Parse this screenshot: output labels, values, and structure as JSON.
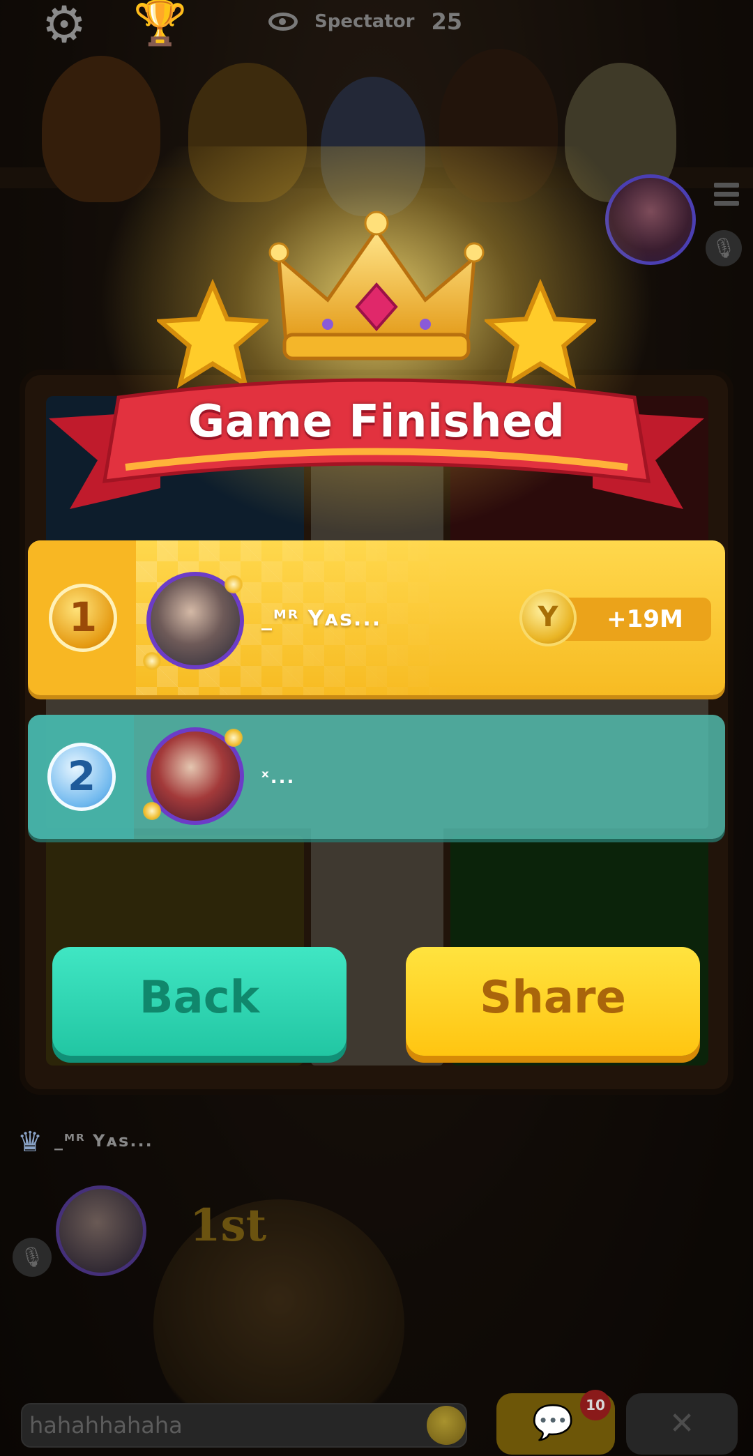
{
  "top_bar": {
    "spectator_label": "Spectator",
    "spectator_count": "25"
  },
  "modal": {
    "title": "Game Finished",
    "ranks": [
      {
        "position": "1",
        "player_name": "_ᴹᴿ Yᴀs...",
        "reward": "+19M"
      },
      {
        "position": "2",
        "player_name": "ˣ..."
      }
    ],
    "back_label": "Back",
    "share_label": "Share"
  },
  "bottom": {
    "player_name": "_ᴹᴿ Yᴀs...",
    "place_label": "1st",
    "chat_text": "hahahhahaha",
    "chat_unread": "10"
  },
  "colors": {
    "rank1_card": "#f7bb22",
    "rank2_card": "#52bfb2",
    "back_button": "#22c6a3",
    "share_button": "#ffc511",
    "ribbon": "#e2323f"
  },
  "icons": [
    "gear-icon",
    "trophy-icon",
    "eye-icon",
    "crown-icon",
    "star-icon",
    "coin-icon",
    "mic-icon",
    "menu-icon",
    "chat-icon",
    "emoji-icon",
    "mute-icon"
  ]
}
